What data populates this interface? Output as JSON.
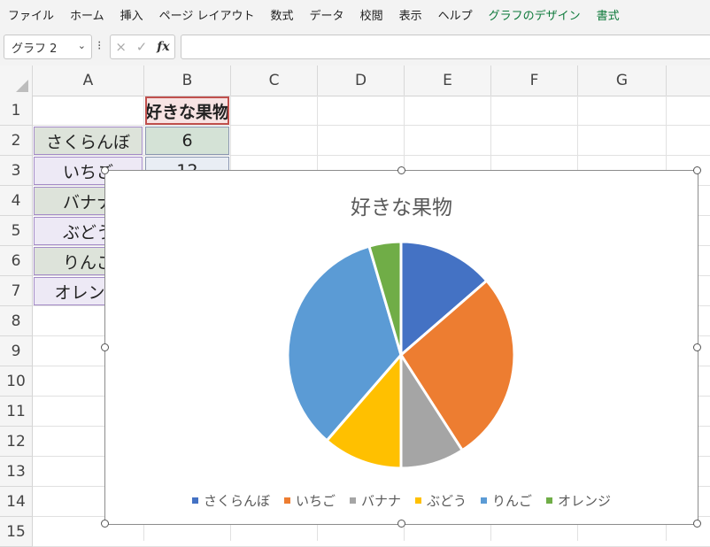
{
  "ribbon": {
    "tabs": [
      {
        "label": "ファイル"
      },
      {
        "label": "ホーム"
      },
      {
        "label": "挿入"
      },
      {
        "label": "ページ レイアウト"
      },
      {
        "label": "数式"
      },
      {
        "label": "データ"
      },
      {
        "label": "校閲"
      },
      {
        "label": "表示"
      },
      {
        "label": "ヘルプ"
      },
      {
        "label": "グラフのデザイン",
        "contextual": true
      },
      {
        "label": "書式",
        "contextual": true
      }
    ]
  },
  "formula_bar": {
    "name_box": "グラフ 2",
    "cancel_symbol": "×",
    "enter_symbol": "✓",
    "fx_label": "fx",
    "formula": ""
  },
  "columns": [
    "A",
    "B",
    "C",
    "D",
    "E",
    "F",
    "G"
  ],
  "rows": [
    "1",
    "2",
    "3",
    "4",
    "5",
    "6",
    "7",
    "8",
    "9",
    "10",
    "11",
    "12",
    "13",
    "14",
    "15"
  ],
  "cells": {
    "B1": "好きな果物",
    "A2": "さくらんぼ",
    "B2": "6",
    "A3": "いちご",
    "B3": "12",
    "A4": "バナナ",
    "A5": "ぶどう",
    "A6": "りんご",
    "A7": "オレンジ"
  },
  "chart_data": {
    "type": "pie",
    "title": "好きな果物",
    "categories": [
      "さくらんぼ",
      "いちご",
      "バナナ",
      "ぶどう",
      "りんご",
      "オレンジ"
    ],
    "values": [
      6,
      12,
      4,
      5,
      15,
      2
    ],
    "colors": [
      "#4472c4",
      "#ed7d31",
      "#a5a5a5",
      "#ffc000",
      "#5b9bd5",
      "#70ad47"
    ],
    "legend": "bottom"
  }
}
